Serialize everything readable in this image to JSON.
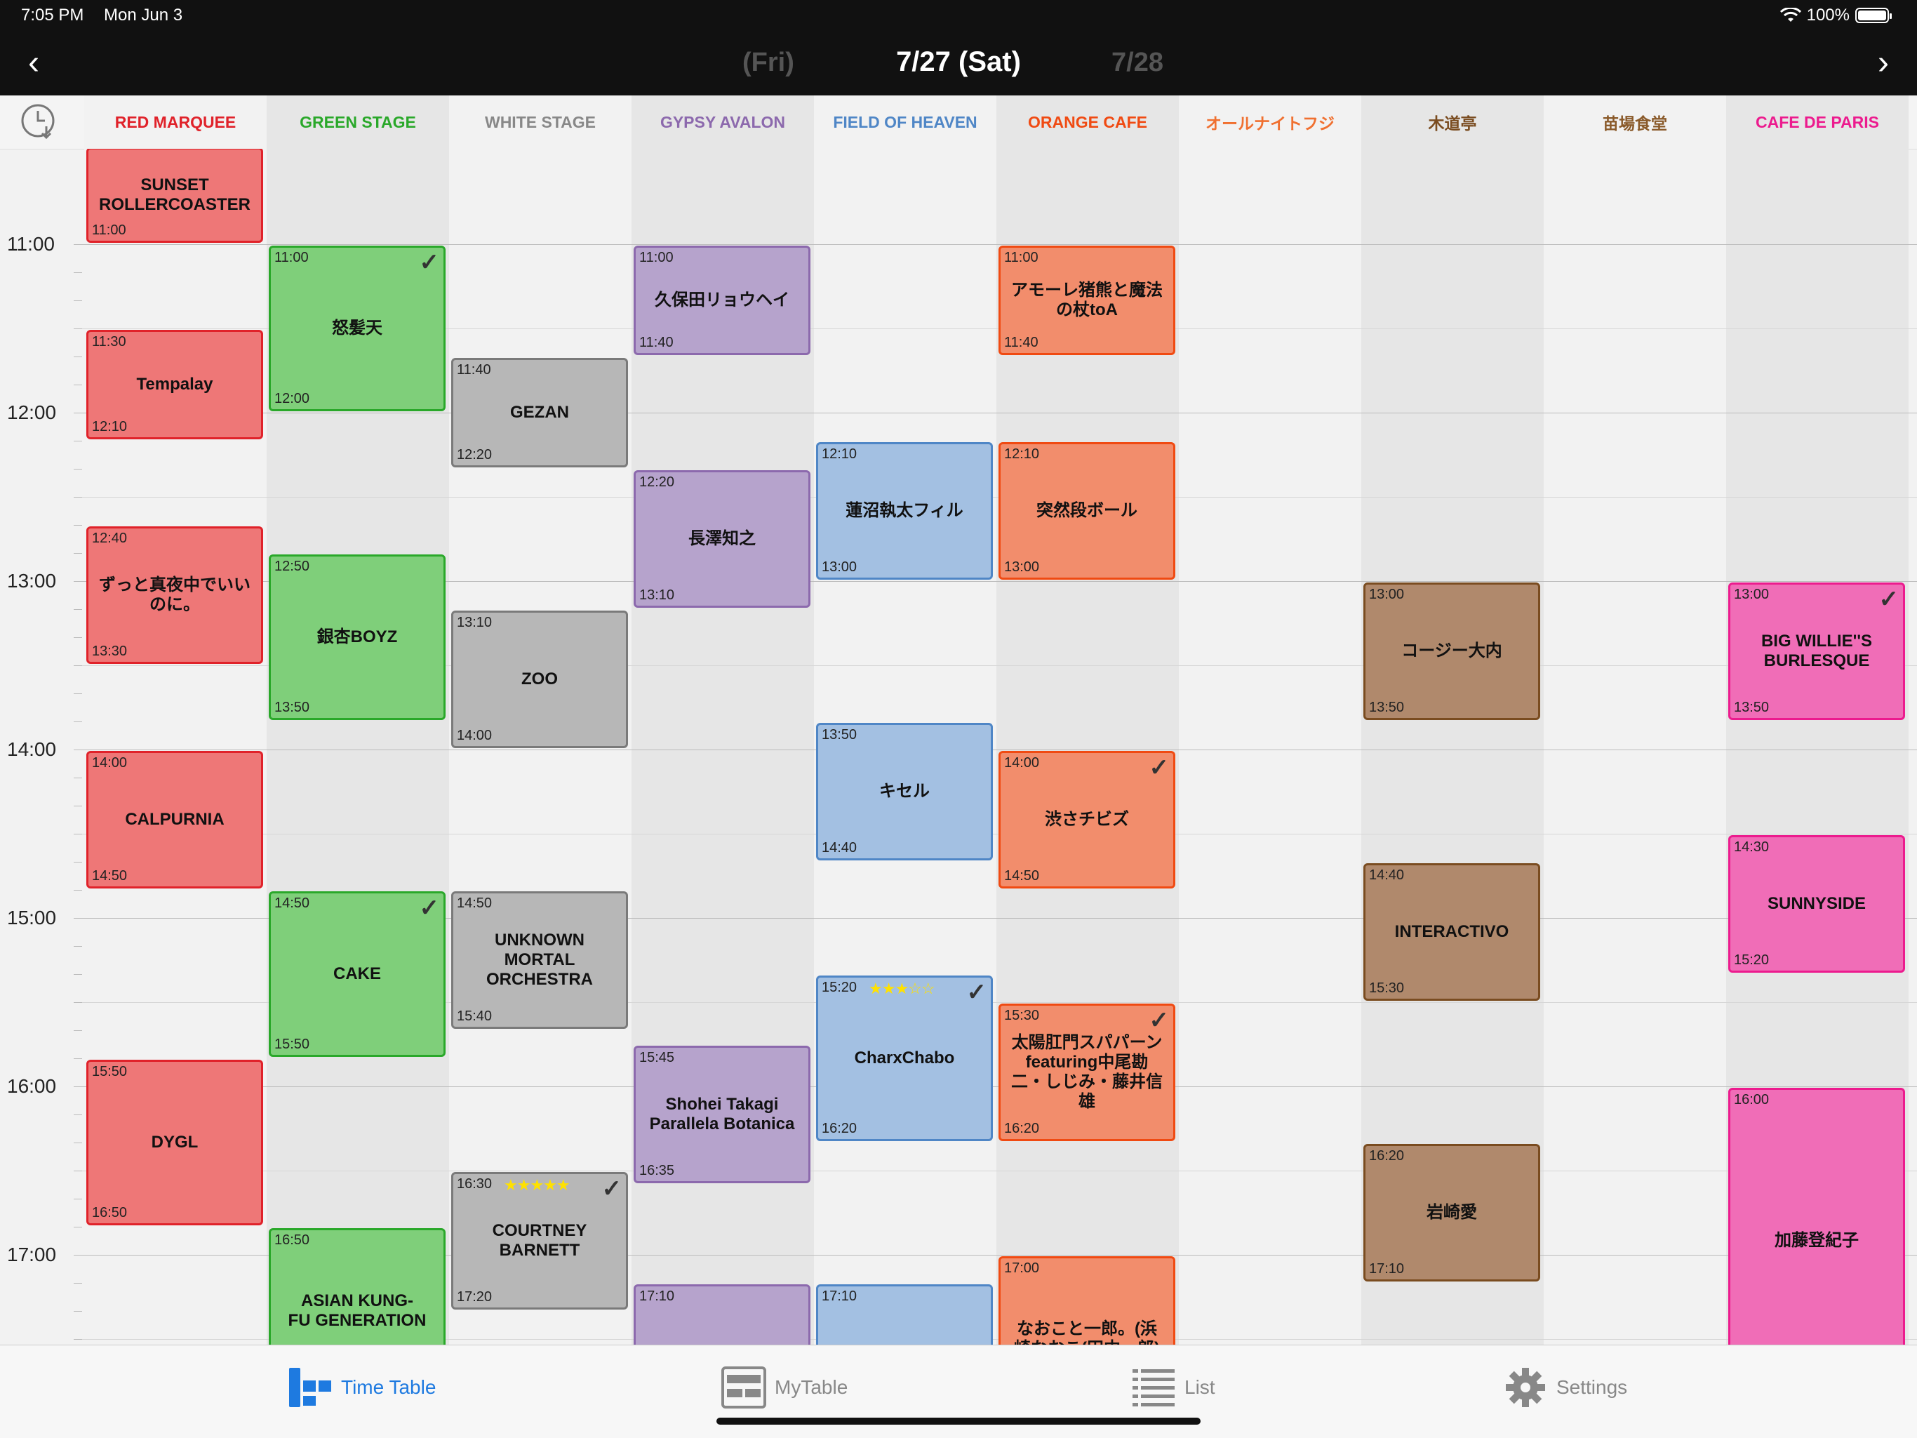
{
  "status": {
    "time": "7:05 PM",
    "date": "Mon Jun 3",
    "battery": "100%"
  },
  "nav": {
    "title": "7/27 (Sat)",
    "prev_day": "(Fri)",
    "next_day": "7/28"
  },
  "stages": [
    {
      "name": "RED MARQUEE",
      "color": "#e0222a",
      "bg": "#f2f2f2"
    },
    {
      "name": "GREEN STAGE",
      "color": "#2aa82a",
      "bg": "#e6e6e6"
    },
    {
      "name": "WHITE STAGE",
      "color": "#888888",
      "bg": "#f2f2f2"
    },
    {
      "name": "GYPSY AVALON",
      "color": "#8c69ad",
      "bg": "#e6e6e6"
    },
    {
      "name": "FIELD OF HEAVEN",
      "color": "#4f86c6",
      "bg": "#f2f2f2"
    },
    {
      "name": "ORANGE CAFE",
      "color": "#f04a12",
      "bg": "#e6e6e6"
    },
    {
      "name": "オールナイトフジ",
      "color": "#f07030",
      "bg": "#f2f2f2"
    },
    {
      "name": "木道亭",
      "color": "#7a4c20",
      "bg": "#e6e6e6"
    },
    {
      "name": "苗場食堂",
      "color": "#8a5a2a",
      "bg": "#f2f2f2"
    },
    {
      "name": "CAFE DE PARIS",
      "color": "#ec1b8e",
      "bg": "#e6e6e6"
    }
  ],
  "hours": [
    "11:00",
    "12:00",
    "13:00",
    "14:00",
    "15:00",
    "16:00",
    "17:00"
  ],
  "events": [
    {
      "col": 0,
      "name": "SUNSET\nROLLERCOASTER",
      "start": "",
      "end": "11:00",
      "s": "10:25",
      "e": "11:00"
    },
    {
      "col": 0,
      "name": "Tempalay",
      "start": "11:30",
      "end": "12:10",
      "s": "11:30",
      "e": "12:10"
    },
    {
      "col": 0,
      "name": "ずっと真夜中でいい\nのに。",
      "start": "12:40",
      "end": "13:30",
      "s": "12:40",
      "e": "13:30"
    },
    {
      "col": 0,
      "name": "CALPURNIA",
      "start": "14:00",
      "end": "14:50",
      "s": "14:00",
      "e": "14:50"
    },
    {
      "col": 0,
      "name": "DYGL",
      "start": "15:50",
      "end": "16:50",
      "s": "15:50",
      "e": "16:50"
    },
    {
      "col": 1,
      "name": "怒髪天",
      "start": "11:00",
      "end": "12:00",
      "s": "11:00",
      "e": "12:00",
      "check": true
    },
    {
      "col": 1,
      "name": "銀杏BOYZ",
      "start": "12:50",
      "end": "13:50",
      "s": "12:50",
      "e": "13:50"
    },
    {
      "col": 1,
      "name": "CAKE",
      "start": "14:50",
      "end": "15:50",
      "s": "14:50",
      "e": "15:50",
      "check": true
    },
    {
      "col": 1,
      "name": "ASIAN KUNG-\nFU GENERATION",
      "start": "16:50",
      "end": "",
      "s": "16:50",
      "e": "17:50"
    },
    {
      "col": 2,
      "name": "GEZAN",
      "start": "11:40",
      "end": "12:20",
      "s": "11:40",
      "e": "12:20"
    },
    {
      "col": 2,
      "name": "ZOO",
      "start": "13:10",
      "end": "14:00",
      "s": "13:10",
      "e": "14:00"
    },
    {
      "col": 2,
      "name": "UNKNOWN\nMORTAL\nORCHESTRA",
      "start": "14:50",
      "end": "15:40",
      "s": "14:50",
      "e": "15:40"
    },
    {
      "col": 2,
      "name": "COURTNEY\nBARNETT",
      "start": "16:30",
      "end": "17:20",
      "s": "16:30",
      "e": "17:20",
      "check": true,
      "stars": "★★★★★"
    },
    {
      "col": 3,
      "name": "久保田リョウヘイ",
      "start": "11:00",
      "end": "11:40",
      "s": "11:00",
      "e": "11:40"
    },
    {
      "col": 3,
      "name": "長澤知之",
      "start": "12:20",
      "end": "13:10",
      "s": "12:20",
      "e": "13:10"
    },
    {
      "col": 3,
      "name": "Shohei Takagi\nParallela Botanica",
      "start": "15:45",
      "end": "16:35",
      "s": "15:45",
      "e": "16:35"
    },
    {
      "col": 3,
      "name": "",
      "start": "17:10",
      "end": "",
      "s": "17:10",
      "e": "18:00"
    },
    {
      "col": 4,
      "name": "蓮沼執太フィル",
      "start": "12:10",
      "end": "13:00",
      "s": "12:10",
      "e": "13:00"
    },
    {
      "col": 4,
      "name": "キセル",
      "start": "13:50",
      "end": "14:40",
      "s": "13:50",
      "e": "14:40"
    },
    {
      "col": 4,
      "name": "CharxChabo",
      "start": "15:20",
      "end": "16:20",
      "s": "15:20",
      "e": "16:20",
      "check": true,
      "stars": "★★★☆☆"
    },
    {
      "col": 4,
      "name": "",
      "start": "17:10",
      "end": "",
      "s": "17:10",
      "e": "18:00"
    },
    {
      "col": 5,
      "name": "アモーレ猪熊と魔法\nの杖toA",
      "start": "11:00",
      "end": "11:40",
      "s": "11:00",
      "e": "11:40"
    },
    {
      "col": 5,
      "name": "突然段ボール",
      "start": "12:10",
      "end": "13:00",
      "s": "12:10",
      "e": "13:00"
    },
    {
      "col": 5,
      "name": "渋さチビズ",
      "start": "14:00",
      "end": "14:50",
      "s": "14:00",
      "e": "14:50",
      "check": true
    },
    {
      "col": 5,
      "name": "太陽肛門スパパーン\nfeaturing中尾勘\n二・しじみ・藤井信\n雄",
      "start": "15:30",
      "end": "16:20",
      "s": "15:30",
      "e": "16:20",
      "check": true
    },
    {
      "col": 5,
      "name": "なおこと一郎。(浜\n崎なおこ(田中一郎)",
      "start": "17:00",
      "end": "",
      "s": "17:00",
      "e": "18:00"
    },
    {
      "col": 7,
      "name": "コージー大内",
      "start": "13:00",
      "end": "13:50",
      "s": "13:00",
      "e": "13:50"
    },
    {
      "col": 7,
      "name": "INTERACTIVO",
      "start": "14:40",
      "end": "15:30",
      "s": "14:40",
      "e": "15:30"
    },
    {
      "col": 7,
      "name": "岩崎愛",
      "start": "16:20",
      "end": "17:10",
      "s": "16:20",
      "e": "17:10"
    },
    {
      "col": 9,
      "name": "BIG WILLIE''S\nBURLESQUE",
      "start": "13:00",
      "end": "13:50",
      "s": "13:00",
      "e": "13:50",
      "check": true
    },
    {
      "col": 9,
      "name": "SUNNYSIDE",
      "start": "14:30",
      "end": "15:20",
      "s": "14:30",
      "e": "15:20"
    },
    {
      "col": 9,
      "name": "加藤登紀子",
      "start": "16:00",
      "end": "",
      "s": "16:00",
      "e": "17:50"
    }
  ],
  "event_colors": [
    {
      "fill": "#ee7777",
      "border": "#e0222a"
    },
    {
      "fill": "#7fcf7a",
      "border": "#2aa82a"
    },
    {
      "fill": "#b7b7b7",
      "border": "#7a7a7a"
    },
    {
      "fill": "#b6a3cc",
      "border": "#8c69ad"
    },
    {
      "fill": "#a3c0e2",
      "border": "#4f86c6"
    },
    {
      "fill": "#f28d6c",
      "border": "#f04a12"
    },
    {
      "fill": "#f28d6c",
      "border": "#f04a12"
    },
    {
      "fill": "#b0896c",
      "border": "#7a4c20"
    },
    {
      "fill": "#b0896c",
      "border": "#7a4c20"
    },
    {
      "fill": "#f06db7",
      "border": "#ec1b8e"
    }
  ],
  "tabs": [
    {
      "label": "Time Table",
      "icon": "timetable-icon",
      "active": true
    },
    {
      "label": "MyTable",
      "icon": "mytable-icon",
      "active": false
    },
    {
      "label": "List",
      "icon": "list-icon",
      "active": false
    },
    {
      "label": "Settings",
      "icon": "gear-icon",
      "active": false
    }
  ]
}
